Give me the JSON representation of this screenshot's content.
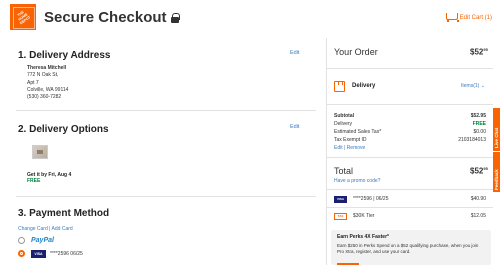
{
  "header": {
    "logo_text": "THE HOME DEPOT",
    "title": "Secure Checkout",
    "cart_label": "Edit Cart (1)"
  },
  "delivery_address": {
    "title": "1. Delivery Address",
    "edit": "Edit",
    "name": "Theresa Mitchell",
    "street": "772 N Oak St,",
    "apt": "Apt 7",
    "city": "Colville, WA 99114",
    "phone": "(530) 360-7282"
  },
  "delivery_options": {
    "title": "2. Delivery Options",
    "edit": "Edit",
    "get_it_by": "Get it by Fri, Aug 4",
    "shipping": "FREE"
  },
  "payment": {
    "title": "3. Payment Method",
    "links": "Change Card | Add Card",
    "options": [
      {
        "label": "PayPal"
      },
      {
        "card_brand": "VISA",
        "label": "****2596 06/25"
      }
    ]
  },
  "order": {
    "title": "Your Order",
    "amount_main": "$52",
    "amount_cents": "95",
    "delivery_label": "Delivery",
    "items_link": "Items(1)",
    "summary": [
      {
        "label": "Subtotal",
        "value": "$52.95",
        "bold": true
      },
      {
        "label": "Delivery",
        "value": "FREE",
        "green": true
      },
      {
        "label": "Estimated Sales Tax*",
        "value": "$0.00"
      },
      {
        "label": "Tax Exempt ID",
        "value": "2103184013"
      }
    ],
    "summary_links": "Edit | Remove",
    "total_label": "Total",
    "total_main": "$52",
    "total_cents": "95",
    "promo": "Have a promo code?",
    "payments": [
      {
        "badge": "VISA",
        "label": "****2596 | 06/25",
        "amount": "$40.90"
      },
      {
        "badge": "TAX",
        "label": "$30K Tier",
        "amount": "$12.05"
      }
    ],
    "perks": {
      "title": "Earn Perks 4X Faster*",
      "text": "Earn $250 in Perks Spend on a $52 qualifying purchase, when you join Pro Xtra, register, and use your card."
    }
  },
  "side_tab": {
    "feedback": "Feedback",
    "live_chat": "Live Chat"
  }
}
